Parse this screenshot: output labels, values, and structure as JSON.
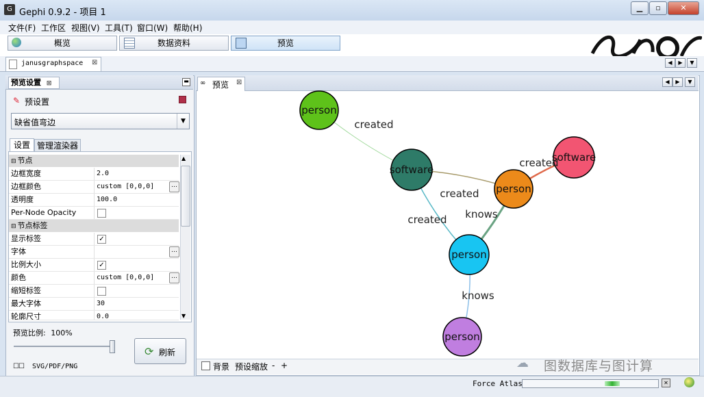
{
  "window": {
    "title": "Gephi 0.9.2 - 项目 1",
    "app_icon": "gephi-icon",
    "minimize": "▁",
    "maximize": "▫",
    "close": "✕"
  },
  "menu": [
    "文件(F)",
    "工作区",
    "视图(V)",
    "工具(T)",
    "窗口(W)",
    "帮助(H)"
  ],
  "toolbar": {
    "overview": "概览",
    "data_lab": "数据资料",
    "preview": "预览"
  },
  "workspace_tab": "janusgraphspace",
  "left_panel": {
    "title": "预览设置",
    "presets_label": "预设置",
    "preset_value": "缺省值弯边",
    "tabs": [
      "设置",
      "管理渲染器"
    ],
    "groups": {
      "nodes": "节点",
      "node_labels": "节点标签"
    },
    "rows": [
      {
        "label": "边框宽度",
        "value": "2.0"
      },
      {
        "label": "边框颜色",
        "value": "custom [0,0,0]"
      },
      {
        "label": "透明度",
        "value": "100.0"
      },
      {
        "label": "Per-Node Opacity",
        "value": ""
      },
      {
        "label": "显示标签",
        "value": "✓"
      },
      {
        "label": "字体",
        "value": ""
      },
      {
        "label": "比例大小",
        "value": "✓"
      },
      {
        "label": "颜色",
        "value": "custom [0,0,0]"
      },
      {
        "label": "缩短标签",
        "value": ""
      },
      {
        "label": "最大字体",
        "value": "30"
      },
      {
        "label": "轮廓尺寸",
        "value": "0.0"
      }
    ],
    "ratio_label": "预览比例:",
    "ratio_value": "100%",
    "refresh": "刷新",
    "export": "SVG/PDF/PNG"
  },
  "preview": {
    "tab_label": "预览",
    "background_label": "背景",
    "zoom_label": "预设缩放",
    "zoom_minus": "-",
    "zoom_plus": "+",
    "graph": {
      "nodes": [
        {
          "id": "n1",
          "label": "person",
          "color": "#5ec21a"
        },
        {
          "id": "n2",
          "label": "software",
          "color": "#2e7b68"
        },
        {
          "id": "n3",
          "label": "software",
          "color": "#f25572"
        },
        {
          "id": "n4",
          "label": "person",
          "color": "#ec8a1a"
        },
        {
          "id": "n5",
          "label": "person",
          "color": "#18c5f2"
        },
        {
          "id": "n6",
          "label": "person",
          "color": "#c07ee0"
        }
      ],
      "edges": [
        {
          "from": "n1",
          "to": "n2",
          "label": "created"
        },
        {
          "from": "n4",
          "to": "n3",
          "label": "created"
        },
        {
          "from": "n4",
          "to": "n2",
          "label": "created"
        },
        {
          "from": "n5",
          "to": "n2",
          "label": "created"
        },
        {
          "from": "n5",
          "to": "n4",
          "label": "knows"
        },
        {
          "from": "n5",
          "to": "n6",
          "label": "knows"
        }
      ]
    }
  },
  "watermark": "图数据库与图计算",
  "status": {
    "layout_name": "Force Atlas"
  }
}
